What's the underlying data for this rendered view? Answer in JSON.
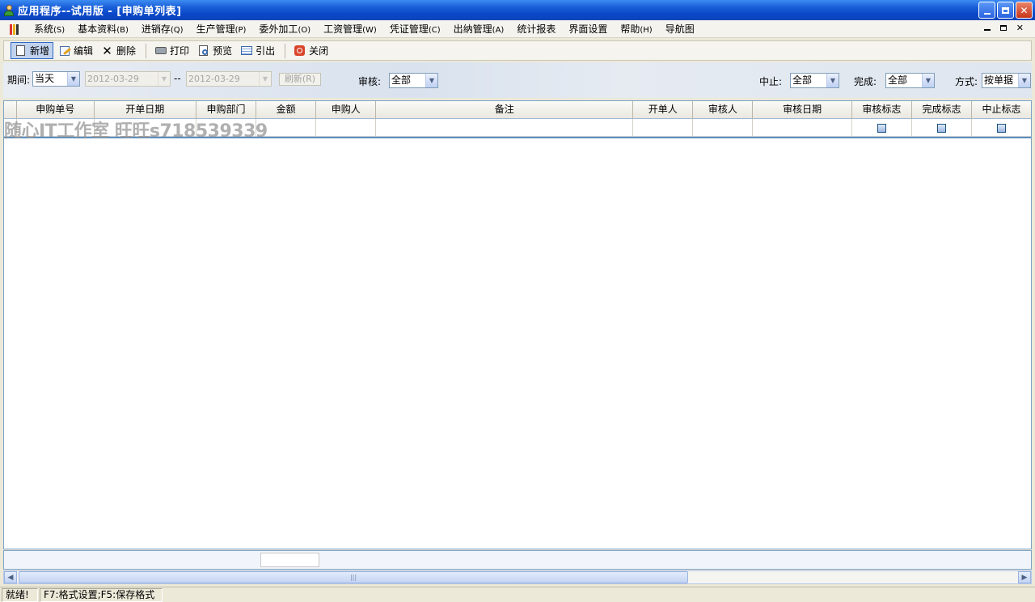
{
  "window": {
    "title": "应用程序--试用版 - [申购单列表]"
  },
  "menu": {
    "items": [
      {
        "label": "系统",
        "key": "(S)"
      },
      {
        "label": "基本资料",
        "key": "(B)"
      },
      {
        "label": "进销存",
        "key": "(Q)"
      },
      {
        "label": "生产管理",
        "key": "(P)"
      },
      {
        "label": "委外加工",
        "key": "(O)"
      },
      {
        "label": "工资管理",
        "key": "(W)"
      },
      {
        "label": "凭证管理",
        "key": "(C)"
      },
      {
        "label": "出纳管理",
        "key": "(A)"
      },
      {
        "label": "统计报表",
        "key": ""
      },
      {
        "label": "界面设置",
        "key": ""
      },
      {
        "label": "帮助",
        "key": "(H)"
      },
      {
        "label": "导航图",
        "key": ""
      }
    ],
    "mdi_min": "▁",
    "mdi_restore": "🗗",
    "mdi_close": "✕"
  },
  "toolbar": {
    "new": "新增",
    "edit": "编辑",
    "delete": "删除",
    "print": "打印",
    "preview": "预览",
    "export": "引出",
    "close": "关闭"
  },
  "filter": {
    "period_label": "期间:",
    "period_value": "当天",
    "date_from": "2012-03-29",
    "date_sep": "--",
    "date_to": "2012-03-29",
    "refresh": "刷新(R)",
    "audit_label": "审核:",
    "audit_value": "全部",
    "stop_label": "中止:",
    "stop_value": "全部",
    "done_label": "完成:",
    "done_value": "全部",
    "mode_label": "方式:",
    "mode_value": "按单据"
  },
  "grid": {
    "columns": [
      "申购单号",
      "开单日期",
      "申购部门",
      "金额",
      "申购人",
      "备注",
      "开单人",
      "审核人",
      "审核日期",
      "审核标志",
      "完成标志",
      "中止标志"
    ],
    "watermark": "随心IT工作室 旺旺s718539339"
  },
  "status": {
    "ready": "就绪!",
    "hint": "F7:格式设置;F5:保存格式"
  }
}
